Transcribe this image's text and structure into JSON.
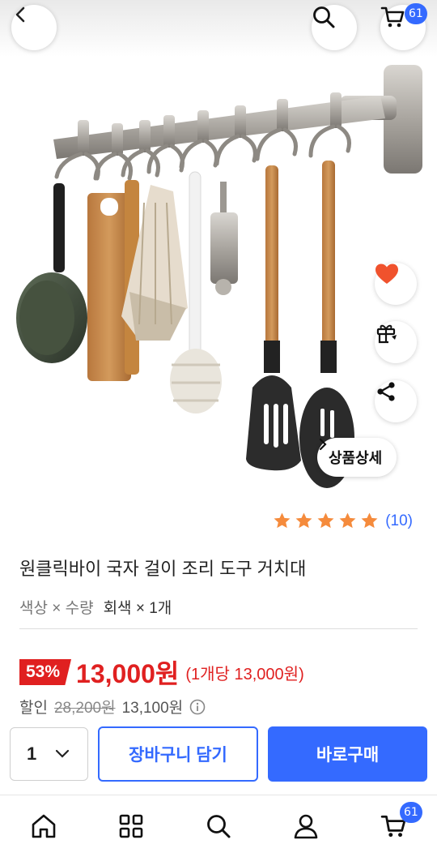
{
  "header": {
    "back_icon": "chevron-left-icon",
    "search_icon": "search-icon",
    "cart_icon": "cart-icon",
    "cart_count": "61"
  },
  "side_actions": {
    "like_icon": "heart-icon",
    "gift_icon": "gift-icon",
    "share_icon": "share-icon",
    "detail_label": "상품상세"
  },
  "product": {
    "rating": 5,
    "review_count": "(10)",
    "title": "원클릭바이 국자 걸이 조리 도구 거치대",
    "option_key": "색상 × 수량",
    "option_value": "회색 × 1개",
    "discount_rate": "53%",
    "price": "13,000원",
    "unit_price": "(1개당 13,000원)",
    "discount_label": "할인",
    "original_price": "28,200원",
    "discount_amount": "13,100원"
  },
  "actions": {
    "quantity": "1",
    "add_to_cart": "장바구니 담기",
    "buy_now": "바로구매"
  },
  "bottom_nav": {
    "items": [
      "home-icon",
      "categories-icon",
      "search-icon",
      "my-page-icon",
      "cart-icon"
    ],
    "cart_count": "61"
  },
  "colors": {
    "accent": "#346aff",
    "sale": "#e02020",
    "star": "#f58b3c",
    "heart": "#f0522d"
  }
}
